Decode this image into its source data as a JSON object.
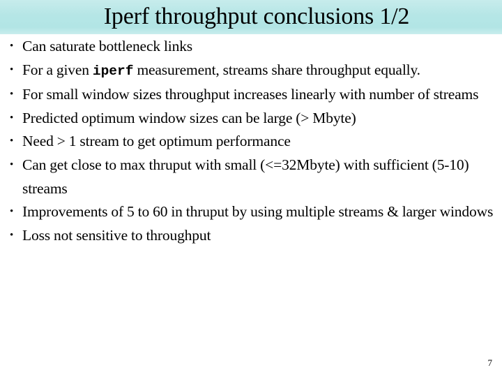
{
  "slide": {
    "title": "Iperf throughput conclusions 1/2",
    "title_band_color": "#b5e6e6",
    "background_color": "#ffffff",
    "text_color": "#000000",
    "page_number": "7",
    "bullet_marker": "•",
    "bullets": [
      {
        "id": "bullet-saturate",
        "text": "Can saturate bottleneck links"
      },
      {
        "id": "bullet-iperf-measurement",
        "pre": "For a given ",
        "mono": "iperf",
        "post": " measurement, streams share throughput equally."
      },
      {
        "id": "bullet-small-window",
        "text": "For small window sizes throughput increases linearly with number of streams"
      },
      {
        "id": "bullet-predicted-optimum",
        "text": "Predicted optimum window sizes can be large (> Mbyte)"
      },
      {
        "id": "bullet-need-streams",
        "text": "Need > 1 stream to get optimum performance"
      },
      {
        "id": "bullet-max-thruput",
        "text": "Can get close to max thruput with small  (<=32Mbyte) with sufficient (5-10) streams"
      },
      {
        "id": "bullet-improvements",
        "text": "Improvements of 5 to 60 in thruput by using multiple streams & larger windows"
      },
      {
        "id": "bullet-loss",
        "text": "Loss not sensitive to throughput"
      }
    ]
  }
}
